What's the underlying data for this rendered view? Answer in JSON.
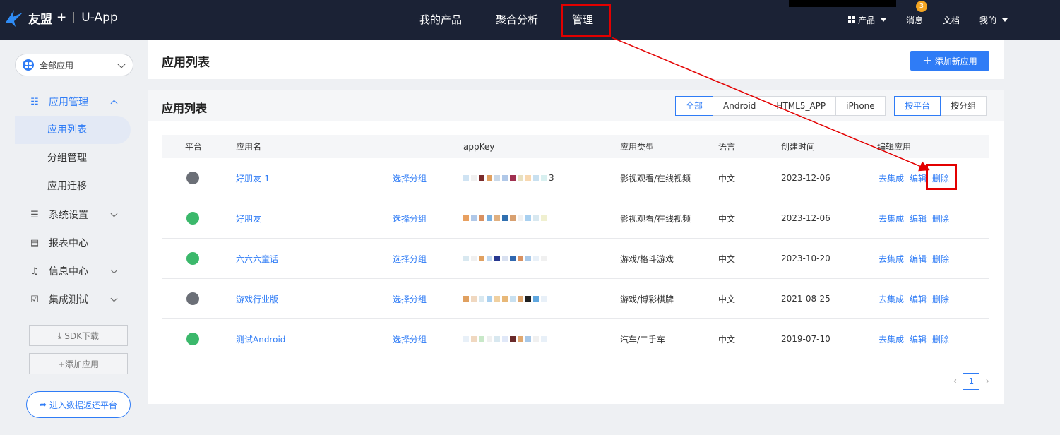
{
  "brand": {
    "name": "友盟",
    "plus": "+",
    "product": "U-App"
  },
  "topnav": {
    "items": [
      {
        "label": "我的产品"
      },
      {
        "label": "聚合分析"
      },
      {
        "label": "管理"
      }
    ],
    "right": {
      "products": "产品",
      "messages": "消息",
      "message_count": "3",
      "docs": "文档",
      "mine": "我的"
    }
  },
  "sidebar": {
    "app_select": "全部应用",
    "menu": [
      {
        "label": "应用管理",
        "icon": "app-manage-icon"
      },
      {
        "label": "系统设置",
        "icon": "settings-icon"
      },
      {
        "label": "报表中心",
        "icon": "report-icon"
      },
      {
        "label": "信息中心",
        "icon": "bell-icon"
      },
      {
        "label": "集成测试",
        "icon": "test-icon"
      }
    ],
    "submenu": [
      {
        "label": "应用列表"
      },
      {
        "label": "分组管理"
      },
      {
        "label": "应用迁移"
      }
    ],
    "sdk_button": "SDK下载",
    "add_app_button": "+添加应用",
    "enter_platform": "进入数据返还平台"
  },
  "header": {
    "title": "应用列表",
    "add_button": "添加新应用"
  },
  "list": {
    "title": "应用列表",
    "filters": [
      "全部",
      "Android",
      "HTML5_APP",
      "iPhone"
    ],
    "groupby": [
      "按平台",
      "按分组"
    ],
    "columns": {
      "platform": "平台",
      "name": "应用名",
      "appkey": "appKey",
      "type": "应用类型",
      "lang": "语言",
      "created": "创建时间",
      "edit": "编辑应用"
    },
    "group_link": "选择分组",
    "actions": {
      "integrate": "去集成",
      "edit": "编辑",
      "delete": "删除"
    },
    "rows": [
      {
        "platform": "ios",
        "name": "好朋友-1",
        "appkey_tail": "3",
        "type": "影视观看/在线视频",
        "lang": "中文",
        "created": "2023-12-06"
      },
      {
        "platform": "android",
        "name": "好朋友",
        "appkey_tail": "",
        "type": "影视观看/在线视频",
        "lang": "中文",
        "created": "2023-12-06"
      },
      {
        "platform": "android",
        "name": "六六六童话",
        "appkey_tail": "",
        "type": "游戏/格斗游戏",
        "lang": "中文",
        "created": "2023-10-20"
      },
      {
        "platform": "ios",
        "name": "游戏行业版",
        "appkey_tail": "",
        "type": "游戏/博彩棋牌",
        "lang": "中文",
        "created": "2021-08-25"
      },
      {
        "platform": "android",
        "name": "测试Android",
        "appkey_tail": "",
        "type": "汽车/二手车",
        "lang": "中文",
        "created": "2019-07-10"
      }
    ],
    "pagination": {
      "current": "1"
    }
  },
  "colors": {
    "accent": "#2f7cf6",
    "nav_bg": "#1b2235",
    "annotation": "#e30000"
  }
}
